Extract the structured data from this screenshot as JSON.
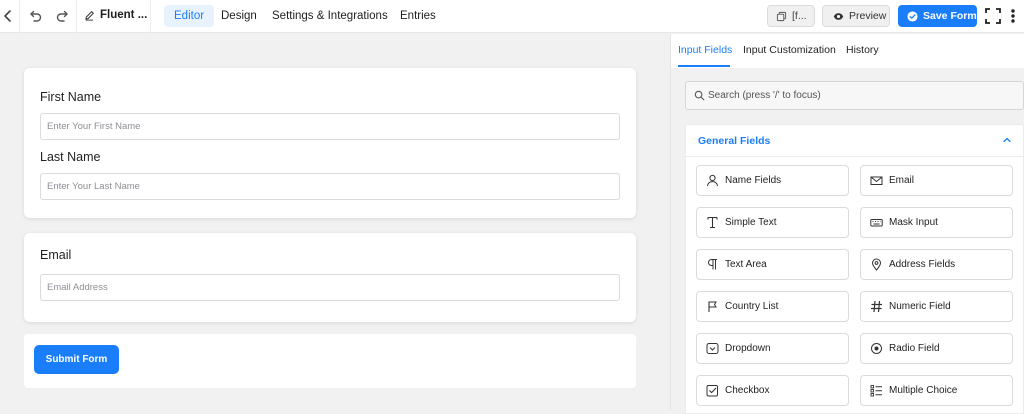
{
  "header": {
    "form_title": "Fluent ...",
    "tabs": [
      {
        "label": "Editor",
        "active": true
      },
      {
        "label": "Design",
        "active": false
      },
      {
        "label": "Settings & Integrations",
        "active": false
      },
      {
        "label": "Entries",
        "active": false
      }
    ],
    "shortcode_label": "[f...",
    "preview_label": "Preview",
    "save_label": "Save Form"
  },
  "form": {
    "fields": [
      {
        "label": "First Name",
        "placeholder": "Enter Your First Name"
      },
      {
        "label": "Last Name",
        "placeholder": "Enter Your Last Name"
      },
      {
        "label": "Email",
        "placeholder": "Email Address"
      }
    ],
    "submit_label": "Submit Form"
  },
  "panel": {
    "tabs": [
      {
        "label": "Input Fields",
        "active": true
      },
      {
        "label": "Input Customization",
        "active": false
      },
      {
        "label": "History",
        "active": false
      }
    ],
    "search_placeholder": "Search (press '/' to focus)",
    "section_title": "General Fields",
    "fields": [
      {
        "label": "Name Fields",
        "icon": "user-icon"
      },
      {
        "label": "Email",
        "icon": "envelope-icon"
      },
      {
        "label": "Simple Text",
        "icon": "text-cursor-icon"
      },
      {
        "label": "Mask Input",
        "icon": "keyboard-icon"
      },
      {
        "label": "Text Area",
        "icon": "paragraph-icon"
      },
      {
        "label": "Address Fields",
        "icon": "map-pin-icon"
      },
      {
        "label": "Country List",
        "icon": "flag-icon"
      },
      {
        "label": "Numeric Field",
        "icon": "hash-icon"
      },
      {
        "label": "Dropdown",
        "icon": "dropdown-icon"
      },
      {
        "label": "Radio Field",
        "icon": "radio-icon"
      },
      {
        "label": "Checkbox",
        "icon": "checkbox-icon"
      },
      {
        "label": "Multiple Choice",
        "icon": "list-icon"
      }
    ]
  },
  "colors": {
    "accent": "#1a7efb",
    "background": "#f1f1f1",
    "text": "#1e1f21"
  }
}
